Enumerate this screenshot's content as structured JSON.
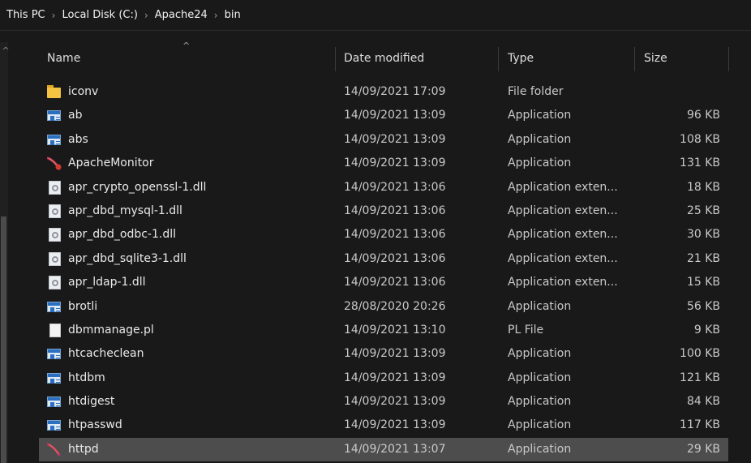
{
  "breadcrumb": [
    "This PC",
    "Local Disk (C:)",
    "Apache24",
    "bin"
  ],
  "breadcrumb_separator": "›",
  "columns": {
    "name": "Name",
    "date": "Date modified",
    "type": "Type",
    "size": "Size"
  },
  "sort_indicator": "^",
  "files": [
    {
      "name": "iconv",
      "date": "14/09/2021 17:09",
      "type": "File folder",
      "size": "",
      "icon": "folder-icon"
    },
    {
      "name": "ab",
      "date": "14/09/2021 13:09",
      "type": "Application",
      "size": "96 KB",
      "icon": "application-icon"
    },
    {
      "name": "abs",
      "date": "14/09/2021 13:09",
      "type": "Application",
      "size": "108 KB",
      "icon": "application-icon"
    },
    {
      "name": "ApacheMonitor",
      "date": "14/09/2021 13:09",
      "type": "Application",
      "size": "131 KB",
      "icon": "apache-monitor-icon"
    },
    {
      "name": "apr_crypto_openssl-1.dll",
      "date": "14/09/2021 13:06",
      "type": "Application exten...",
      "size": "18 KB",
      "icon": "dll-icon"
    },
    {
      "name": "apr_dbd_mysql-1.dll",
      "date": "14/09/2021 13:06",
      "type": "Application exten...",
      "size": "25 KB",
      "icon": "dll-icon"
    },
    {
      "name": "apr_dbd_odbc-1.dll",
      "date": "14/09/2021 13:06",
      "type": "Application exten...",
      "size": "30 KB",
      "icon": "dll-icon"
    },
    {
      "name": "apr_dbd_sqlite3-1.dll",
      "date": "14/09/2021 13:06",
      "type": "Application exten...",
      "size": "21 KB",
      "icon": "dll-icon"
    },
    {
      "name": "apr_ldap-1.dll",
      "date": "14/09/2021 13:06",
      "type": "Application exten...",
      "size": "15 KB",
      "icon": "dll-icon"
    },
    {
      "name": "brotli",
      "date": "28/08/2020 20:26",
      "type": "Application",
      "size": "56 KB",
      "icon": "application-icon"
    },
    {
      "name": "dbmmanage.pl",
      "date": "14/09/2021 13:10",
      "type": "PL File",
      "size": "9 KB",
      "icon": "file-icon"
    },
    {
      "name": "htcacheclean",
      "date": "14/09/2021 13:09",
      "type": "Application",
      "size": "100 KB",
      "icon": "application-icon"
    },
    {
      "name": "htdbm",
      "date": "14/09/2021 13:09",
      "type": "Application",
      "size": "121 KB",
      "icon": "application-icon"
    },
    {
      "name": "htdigest",
      "date": "14/09/2021 13:09",
      "type": "Application",
      "size": "84 KB",
      "icon": "application-icon"
    },
    {
      "name": "htpasswd",
      "date": "14/09/2021 13:09",
      "type": "Application",
      "size": "117 KB",
      "icon": "application-icon"
    },
    {
      "name": "httpd",
      "date": "14/09/2021 13:07",
      "type": "Application",
      "size": "29 KB",
      "icon": "apache-feather-icon",
      "selected": true
    }
  ]
}
